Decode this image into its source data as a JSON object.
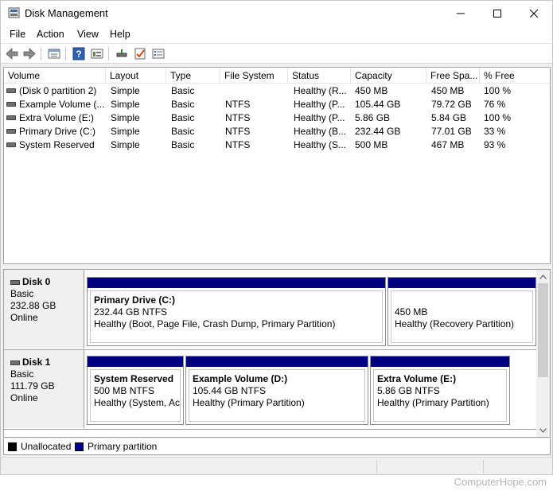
{
  "window": {
    "title": "Disk Management",
    "icon": "disk-management-icon"
  },
  "menu": [
    "File",
    "Action",
    "View",
    "Help"
  ],
  "toolbar": [
    "back-arrow-icon",
    "forward-arrow-icon",
    "properties-icon",
    "help-icon",
    "list-view-icon",
    "connect-icon",
    "check-icon",
    "rescan-icon"
  ],
  "list": {
    "columns": [
      "Volume",
      "Layout",
      "Type",
      "File System",
      "Status",
      "Capacity",
      "Free Spa...",
      "% Free"
    ],
    "rows": [
      {
        "volume": "(Disk 0 partition 2)",
        "layout": "Simple",
        "type": "Basic",
        "fs": "",
        "status": "Healthy (R...",
        "capacity": "450 MB",
        "free": "450 MB",
        "pct": "100 %"
      },
      {
        "volume": "Example Volume (...",
        "layout": "Simple",
        "type": "Basic",
        "fs": "NTFS",
        "status": "Healthy (P...",
        "capacity": "105.44 GB",
        "free": "79.72 GB",
        "pct": "76 %"
      },
      {
        "volume": "Extra Volume (E:)",
        "layout": "Simple",
        "type": "Basic",
        "fs": "NTFS",
        "status": "Healthy (P...",
        "capacity": "5.86 GB",
        "free": "5.84 GB",
        "pct": "100 %"
      },
      {
        "volume": "Primary Drive (C:)",
        "layout": "Simple",
        "type": "Basic",
        "fs": "NTFS",
        "status": "Healthy (B...",
        "capacity": "232.44 GB",
        "free": "77.01 GB",
        "pct": "33 %"
      },
      {
        "volume": "System Reserved",
        "layout": "Simple",
        "type": "Basic",
        "fs": "NTFS",
        "status": "Healthy (S...",
        "capacity": "500 MB",
        "free": "467 MB",
        "pct": "93 %"
      }
    ]
  },
  "disks": [
    {
      "name": "Disk 0",
      "type": "Basic",
      "size": "232.88 GB",
      "state": "Online",
      "partitions": [
        {
          "name": "Primary Drive  (C:)",
          "detail": "232.44 GB NTFS",
          "status": "Healthy (Boot, Page File, Crash Dump, Primary Partition)"
        },
        {
          "name": "",
          "detail": "450 MB",
          "status": "Healthy (Recovery Partition)"
        }
      ]
    },
    {
      "name": "Disk 1",
      "type": "Basic",
      "size": "111.79 GB",
      "state": "Online",
      "partitions": [
        {
          "name": "System Reserved",
          "detail": "500 MB NTFS",
          "status": "Healthy (System, Active, Primary Partition)"
        },
        {
          "name": "Example Volume  (D:)",
          "detail": "105.44 GB NTFS",
          "status": "Healthy (Primary Partition)"
        },
        {
          "name": "Extra Volume  (E:)",
          "detail": "5.86 GB NTFS",
          "status": "Healthy (Primary Partition)"
        }
      ]
    }
  ],
  "legend": [
    {
      "label": "Unallocated",
      "color": "#000000"
    },
    {
      "label": "Primary partition",
      "color": "#000080"
    }
  ],
  "watermark": "ComputerHope.com"
}
